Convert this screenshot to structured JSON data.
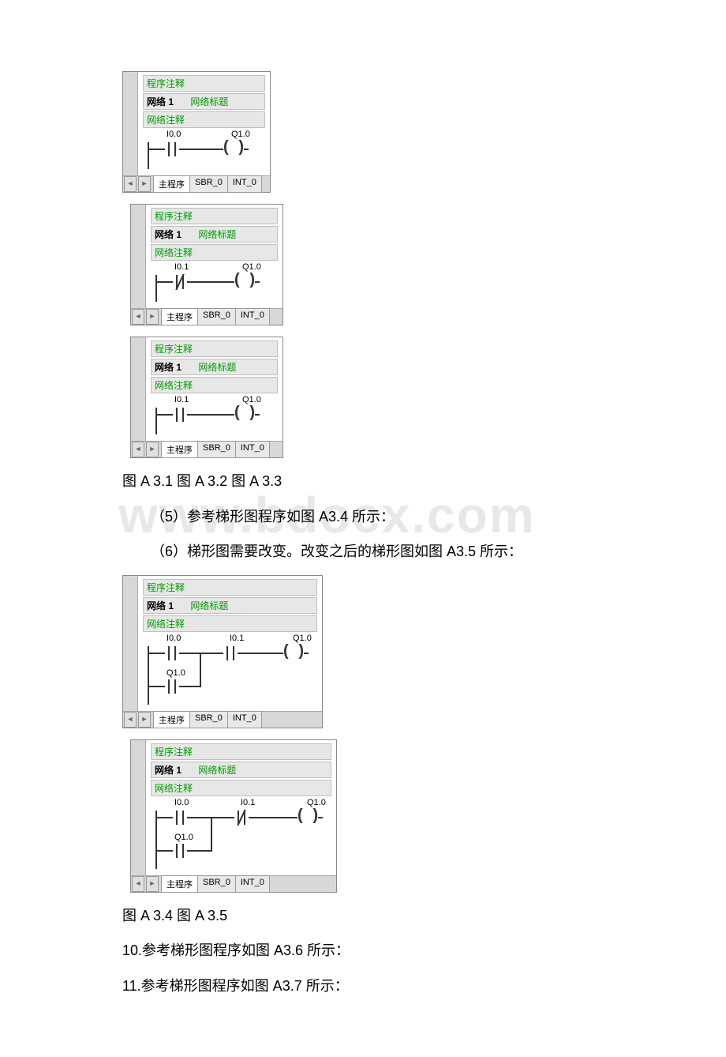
{
  "watermark": "www.bdocx.com",
  "editor_common": {
    "prog_comment": "程序注释",
    "net_label": "网络 1",
    "net_title": "网络标题",
    "net_comment": "网络注释",
    "tab_main": "主程序",
    "tab_sbr": "SBR_0",
    "tab_int": "INT_0",
    "nav_left": "◄",
    "nav_right": "►"
  },
  "fig1": {
    "contact": "I0.0",
    "coil": "Q1.0"
  },
  "fig2": {
    "contact": "I0.1",
    "coil": "Q1.0"
  },
  "fig3": {
    "contact": "I0.1",
    "coil": "Q1.0"
  },
  "fig4": {
    "c1": "I0.0",
    "c2": "I0.1",
    "hold": "Q1.0",
    "coil": "Q1.0"
  },
  "fig5": {
    "c1": "I0.0",
    "c2": "I0.1",
    "hold": "Q1.0",
    "coil": "Q1.0"
  },
  "text": {
    "caption_123": "图 A 3.1 图 A 3.2 图 A 3.3",
    "line5": "（5）参考梯形图程序如图 A3.4 所示：",
    "line6": "（6）梯形图需要改变。改变之后的梯形图如图 A3.5 所示：",
    "caption_45": "图 A 3.4 图 A 3.5",
    "line10": "10.参考梯形图程序如图 A3.6 所示：",
    "line11": "11.参考梯形图程序如图 A3.7 所示："
  }
}
